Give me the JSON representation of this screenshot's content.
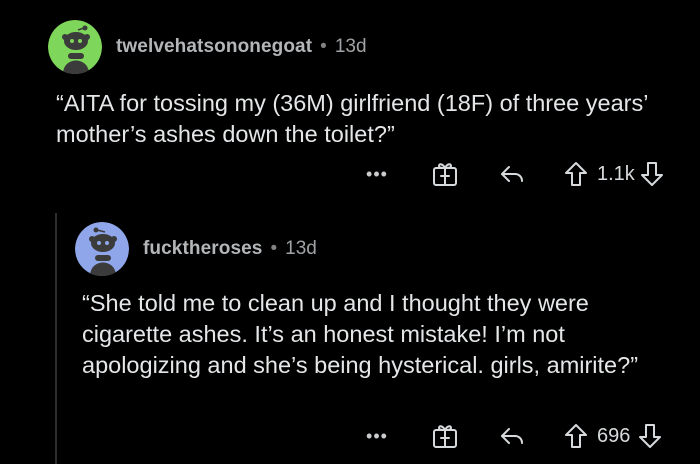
{
  "comments": [
    {
      "username": "twelvehatsononegoat",
      "separator": "•",
      "age": "13d",
      "body": "“AITA for tossing my (36M) girlfriend (18F) of three years’ mother’s ashes down the toilet?”",
      "more_label": "•••",
      "score": "1.1k",
      "avatar_color": "#7ed65a",
      "icons": [
        "more-icon",
        "award-icon",
        "reply-icon",
        "upvote-icon",
        "downvote-icon"
      ]
    },
    {
      "username": "fucktheroses",
      "separator": "•",
      "age": "13d",
      "body": "“She told me to clean up and I thought they were cigarette ashes. It’s an honest mistake! I’m not apologizing and she’s being hysterical. girls, amirite?”",
      "more_label": "•••",
      "score": "696",
      "avatar_color": "#8fa6ea",
      "icons": [
        "more-icon",
        "award-icon",
        "reply-icon",
        "upvote-icon",
        "downvote-icon"
      ]
    }
  ],
  "theme": {
    "background": "#000000",
    "text": "#e4e6e8",
    "meta_text": "#b3b6b8"
  }
}
